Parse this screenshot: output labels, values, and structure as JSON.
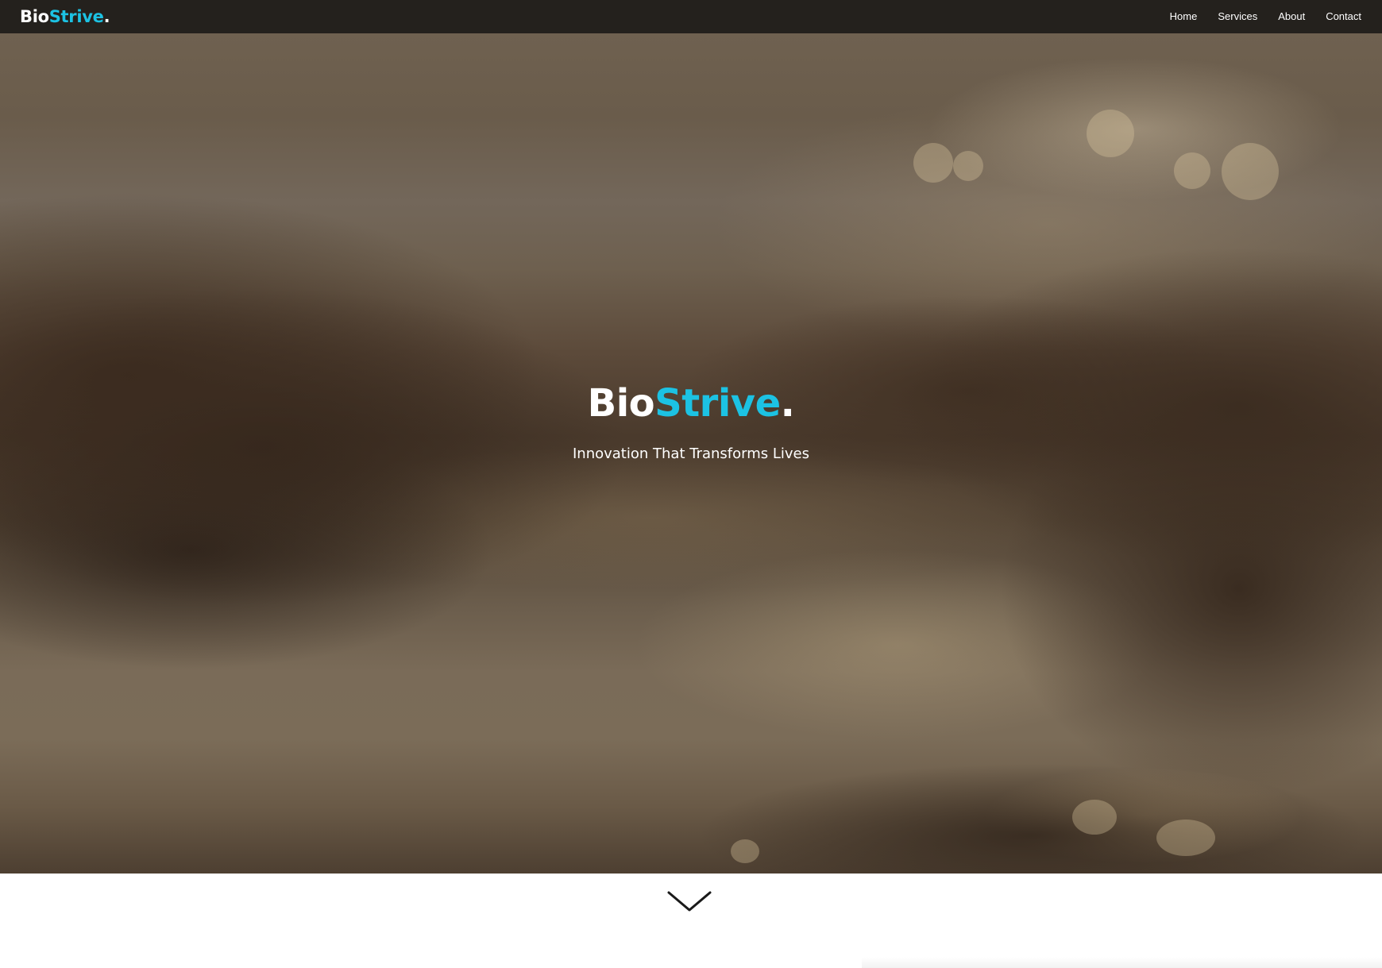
{
  "nav": {
    "brand": {
      "part1": "Bio",
      "part2": "Strive",
      "dot": "."
    },
    "links": [
      {
        "label": "Home"
      },
      {
        "label": "Services"
      },
      {
        "label": "About"
      },
      {
        "label": "Contact"
      }
    ]
  },
  "hero": {
    "title": {
      "part1": "Bio",
      "part2": "Strive",
      "dot": "."
    },
    "subtitle": "Innovation That Transforms Lives",
    "background_image": "blurred-sunset-tide-pool-photo"
  },
  "scroll_indicator": {
    "icon": "chevron-down-icon"
  },
  "colors": {
    "accent": "#1cc2e3",
    "navbar_bg": "#24211d",
    "text_light": "#ffffff",
    "page_bg": "#ffffff"
  }
}
